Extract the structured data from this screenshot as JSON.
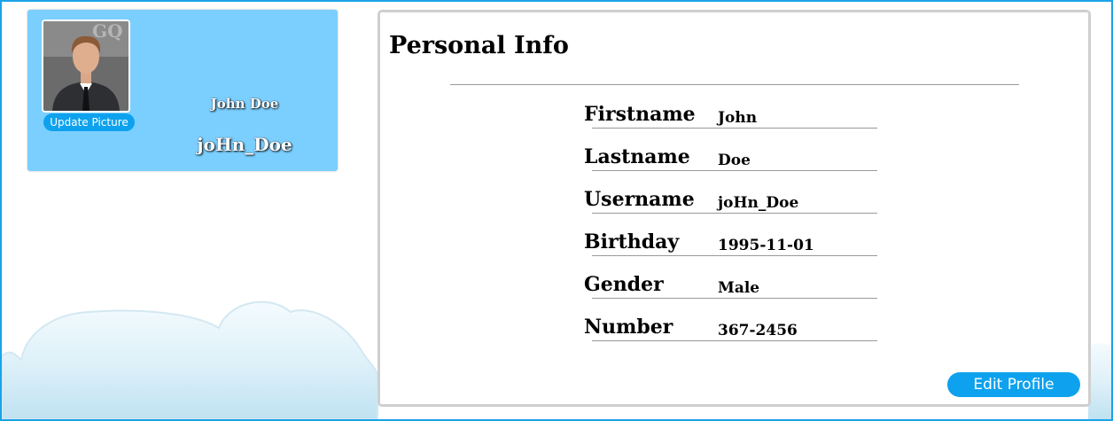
{
  "profile_card": {
    "name": "John Doe",
    "username": "joHn_Doe",
    "update_picture_label": "Update Picture"
  },
  "info": {
    "title": "Personal Info",
    "fields": [
      {
        "label": "Firstname",
        "value": "John"
      },
      {
        "label": "Lastname",
        "value": "Doe"
      },
      {
        "label": "Username",
        "value": "joHn_Doe"
      },
      {
        "label": "Birthday",
        "value": "1995-11-01"
      },
      {
        "label": "Gender",
        "value": "Male"
      },
      {
        "label": "Number",
        "value": "367-2456"
      }
    ],
    "edit_label": "Edit Profile"
  },
  "colors": {
    "accent": "#0ea2ee",
    "card_background": "#7bcfff",
    "frame_border": "#1aa3e8"
  }
}
